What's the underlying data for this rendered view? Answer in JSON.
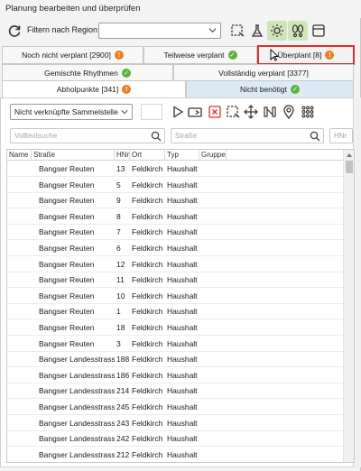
{
  "window": {
    "title": "Planung bearbeiten und überprüfen"
  },
  "toolbar": {
    "filter_label": "Filtern nach Region",
    "region_value": ""
  },
  "tabs_row1": [
    {
      "label": "Noch nicht verplant [2900]",
      "badge": "!",
      "badge_type": "orange"
    },
    {
      "label": "Teilweise verplant",
      "badge": "✓",
      "badge_type": "green"
    },
    {
      "label": "Überplant [8]",
      "badge": "!",
      "badge_type": "orange"
    }
  ],
  "tabs_row2": [
    {
      "label": "Gemischte Rhythmen",
      "badge": "✓",
      "badge_type": "green"
    },
    {
      "label": "Vollständig verplant [3377]"
    }
  ],
  "tabs_row3": [
    {
      "label": "Abholpunkte [341]",
      "badge": "!",
      "badge_type": "orange"
    },
    {
      "label": "Nicht benötigt",
      "badge": "✓",
      "badge_type": "green"
    }
  ],
  "actions": {
    "assign_select_value": "Nicht verknüpfte Sammelstelle"
  },
  "search": {
    "fulltext_placeholder": "Volltextsuche",
    "street_placeholder": "Straße",
    "hnr_placeholder": "HNr"
  },
  "grid": {
    "columns": [
      "Name",
      "Straße",
      "HNr",
      "Ort",
      "Typ",
      "Gruppe"
    ],
    "rows": [
      [
        "",
        "Bangser Reuten",
        "13",
        "Feldkirch",
        "Haushalt",
        ""
      ],
      [
        "",
        "Bangser Reuten",
        "5",
        "Feldkirch",
        "Haushalt",
        ""
      ],
      [
        "",
        "Bangser Reuten",
        "9",
        "Feldkirch",
        "Haushalt",
        ""
      ],
      [
        "",
        "Bangser Reuten",
        "8",
        "Feldkirch",
        "Haushalt",
        ""
      ],
      [
        "",
        "Bangser Reuten",
        "7",
        "Feldkirch",
        "Haushalt",
        ""
      ],
      [
        "",
        "Bangser Reuten",
        "6",
        "Feldkirch",
        "Haushalt",
        ""
      ],
      [
        "",
        "Bangser Reuten",
        "12",
        "Feldkirch",
        "Haushalt",
        ""
      ],
      [
        "",
        "Bangser Reuten",
        "11",
        "Feldkirch",
        "Haushalt",
        ""
      ],
      [
        "",
        "Bangser Reuten",
        "10",
        "Feldkirch",
        "Haushalt",
        ""
      ],
      [
        "",
        "Bangser Reuten",
        "1",
        "Feldkirch",
        "Haushalt",
        ""
      ],
      [
        "",
        "Bangser Reuten",
        "18",
        "Feldkirch",
        "Haushalt",
        ""
      ],
      [
        "",
        "Bangser Reuten",
        "3",
        "Feldkirch",
        "Haushalt",
        ""
      ],
      [
        "",
        "Bangser Landesstrasse",
        "188",
        "Feldkirch",
        "Haushalt",
        ""
      ],
      [
        "",
        "Bangser Landesstrasse",
        "186",
        "Feldkirch",
        "Haushalt",
        ""
      ],
      [
        "",
        "Bangser Landesstrasse",
        "214",
        "Feldkirch",
        "Haushalt",
        ""
      ],
      [
        "",
        "Bangser Landesstrasse",
        "245",
        "Feldkirch",
        "Haushalt",
        ""
      ],
      [
        "",
        "Bangser Landesstrasse",
        "243",
        "Feldkirch",
        "Haushalt",
        ""
      ],
      [
        "",
        "Bangser Landesstrasse",
        "242",
        "Feldkirch",
        "Haushalt",
        ""
      ],
      [
        "",
        "Bangser Landesstrasse",
        "212",
        "Feldkirch",
        "Haushalt",
        ""
      ]
    ]
  },
  "colors": {
    "accent_green": "#cfe5b8",
    "badge_orange": "#f07c1b",
    "badge_green": "#5cb33b",
    "highlight_red": "#d93030",
    "tab_blue": "#dceaf6"
  }
}
